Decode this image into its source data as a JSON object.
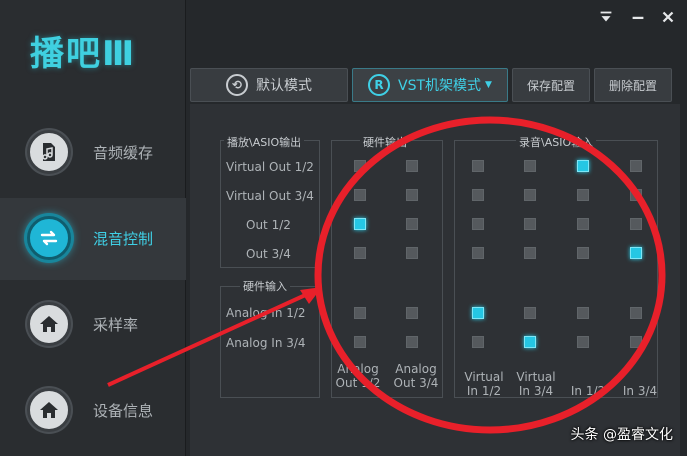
{
  "app": {
    "logo_text": "播吧Ⅲ"
  },
  "sidebar": {
    "items": [
      {
        "label": "音频缓存",
        "icon": "music-file-icon"
      },
      {
        "label": "混音控制",
        "icon": "swap-arrows-icon",
        "active": true
      },
      {
        "label": "采样率",
        "icon": "home-icon"
      },
      {
        "label": "设备信息",
        "icon": "home-icon"
      }
    ]
  },
  "window_controls": [
    "menu-icon",
    "minimize-icon",
    "close-icon"
  ],
  "tabs": [
    {
      "label": "默认模式",
      "icon": "refresh-icon"
    },
    {
      "label": "VST机架模式",
      "icon": "registered-icon",
      "active": true,
      "dropdown": true
    },
    {
      "label": "保存配置"
    },
    {
      "label": "删除配置"
    }
  ],
  "matrix": {
    "playback_title": "播放\\ASIO输出",
    "hw_input_title": "硬件输入",
    "hw_output_title": "硬件输出",
    "record_title": "录音\\ASIO输入",
    "row_labels": [
      "Virtual Out 1/2",
      "Virtual Out 3/4",
      "Out 1/2",
      "Out 3/4",
      "Analog In 1/2",
      "Analog In 3/4"
    ],
    "hw_output_cols": [
      "Analog Out 1/2",
      "Analog Out 3/4"
    ],
    "record_cols": [
      "Virtual In 1/2",
      "Virtual In 3/4",
      "In 1/2",
      "In 3/4"
    ],
    "hw_output_grid": [
      [
        0,
        0
      ],
      [
        0,
        0
      ],
      [
        1,
        0
      ],
      [
        0,
        0
      ],
      [
        0,
        0
      ],
      [
        0,
        0
      ]
    ],
    "record_grid": [
      [
        0,
        0,
        1,
        0
      ],
      [
        0,
        0,
        0,
        0
      ],
      [
        0,
        0,
        0,
        0
      ],
      [
        0,
        0,
        0,
        1
      ],
      [
        1,
        0,
        0,
        0
      ],
      [
        0,
        1,
        0,
        0
      ]
    ]
  },
  "colors": {
    "accent": "#25c7e4",
    "annotation": "#e8202a"
  },
  "watermark": "头条 @盈睿文化"
}
